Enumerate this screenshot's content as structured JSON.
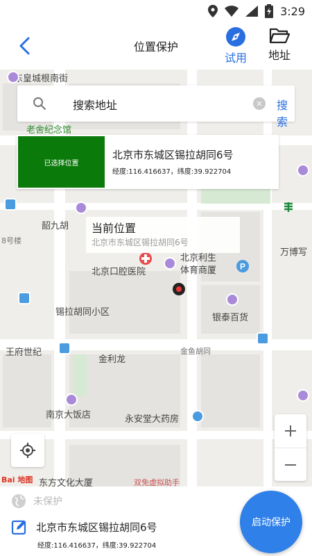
{
  "status_bar": {
    "time": "3:29"
  },
  "header": {
    "title": "位置保护",
    "trial_label": "试用",
    "address_label": "地址"
  },
  "search": {
    "placeholder": "搜索地址",
    "button": "搜索"
  },
  "selected_card": {
    "thumb_label": "已选择位置",
    "address": "北京市东城区锡拉胡同6号",
    "coords": "经度:116.416637，纬度:39.922704"
  },
  "current_card": {
    "title": "当前位置",
    "address": "北京市东城区锡拉胡同6号"
  },
  "map_labels": {
    "l1": "东皇城根南街",
    "l2": "老舍纪念馆",
    "l3": "韶九胡",
    "l4": "8号楼",
    "l5": "北京口腔医院",
    "l6": "北京利生",
    "l7": "体育商厦",
    "l8": "锡拉胡同小区",
    "l9": "银泰百货",
    "l10": "王府世纪",
    "l11": "金鱼胡同",
    "l12": "金利龙",
    "l13": "南京大饭店",
    "l14": "永安堂大药房",
    "l15": "万博写",
    "l16": "东方文化大厦",
    "l17": "双免虚拟助手",
    "logo": "Bai 地图"
  },
  "bottom": {
    "status": "未保护",
    "address": "北京市东城区锡拉胡同6号",
    "coords": "经度:116.416637，纬度:39.922704",
    "start_button": "启动保护"
  },
  "colors": {
    "accent": "#2f80e8",
    "link": "#2a6fe0",
    "thumb": "#0a7a0a"
  }
}
